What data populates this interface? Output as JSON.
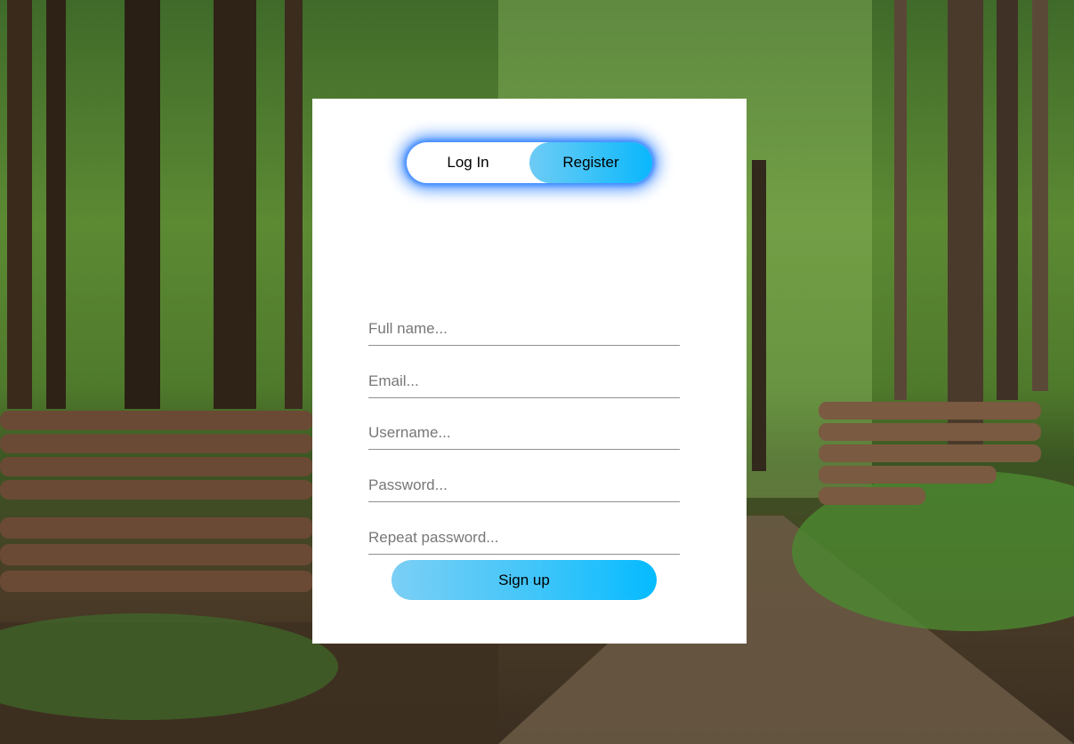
{
  "auth_toggle": {
    "login_label": "Log In",
    "register_label": "Register",
    "active": "register"
  },
  "register_form": {
    "full_name_placeholder": "Full name...",
    "email_placeholder": "Email...",
    "username_placeholder": "Username...",
    "password_placeholder": "Password...",
    "repeat_password_placeholder": "Repeat password...",
    "submit_label": "Sign up"
  },
  "colors": {
    "accent_gradient_start": "#7bcff5",
    "accent_gradient_end": "#05bbff",
    "toggle_glow": "#3d8bff",
    "card_background": "#ffffff"
  }
}
